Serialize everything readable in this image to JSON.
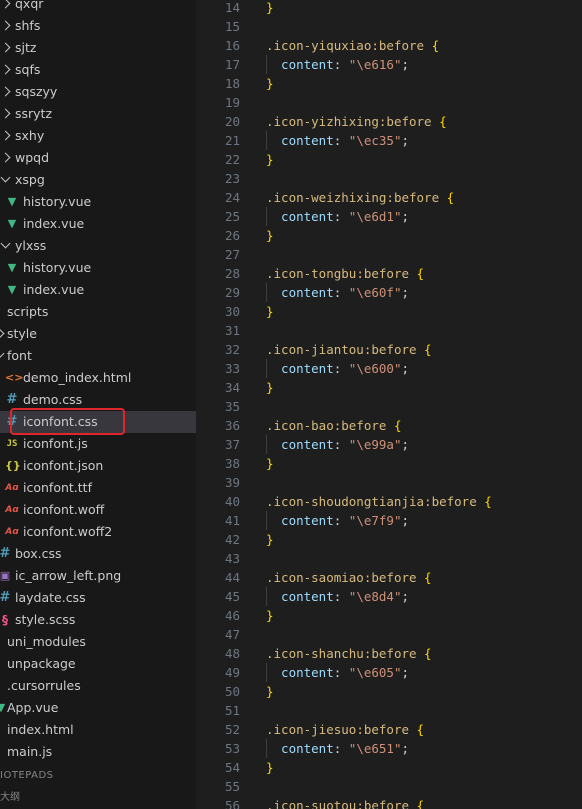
{
  "explorer": {
    "items": [
      {
        "label": "qxqr",
        "kind": "folder",
        "state": "closed",
        "depth": 0
      },
      {
        "label": "shfs",
        "kind": "folder",
        "state": "closed",
        "depth": 0
      },
      {
        "label": "sjtz",
        "kind": "folder",
        "state": "closed",
        "depth": 0
      },
      {
        "label": "sqfs",
        "kind": "folder",
        "state": "closed",
        "depth": 0
      },
      {
        "label": "sqszyy",
        "kind": "folder",
        "state": "closed",
        "depth": 0
      },
      {
        "label": "ssrytz",
        "kind": "folder",
        "state": "closed",
        "depth": 0
      },
      {
        "label": "sxhy",
        "kind": "folder",
        "state": "closed",
        "depth": 0
      },
      {
        "label": "wpqd",
        "kind": "folder",
        "state": "closed",
        "depth": 0
      },
      {
        "label": "xspg",
        "kind": "folder",
        "state": "open",
        "depth": 0
      },
      {
        "label": "history.vue",
        "kind": "vue",
        "depth": 1
      },
      {
        "label": "index.vue",
        "kind": "vue",
        "depth": 1
      },
      {
        "label": "ylxss",
        "kind": "folder",
        "state": "open",
        "depth": 0
      },
      {
        "label": "history.vue",
        "kind": "vue",
        "depth": 1
      },
      {
        "label": "index.vue",
        "kind": "vue",
        "depth": 1
      },
      {
        "label": "scripts",
        "kind": "folder-plain",
        "depth": -1
      },
      {
        "label": "style",
        "kind": "folder",
        "state": "closed",
        "depth": -1
      },
      {
        "label": "font",
        "kind": "folder",
        "state": "open",
        "depth": -1
      },
      {
        "label": "demo_index.html",
        "kind": "html",
        "depth": 1
      },
      {
        "label": "demo.css",
        "kind": "css",
        "depth": 1
      },
      {
        "label": "iconfont.css",
        "kind": "css",
        "depth": 1,
        "selected": true
      },
      {
        "label": "iconfont.js",
        "kind": "js",
        "depth": 1
      },
      {
        "label": "iconfont.json",
        "kind": "json",
        "depth": 1
      },
      {
        "label": "iconfont.ttf",
        "kind": "font",
        "depth": 1
      },
      {
        "label": "iconfont.woff",
        "kind": "font",
        "depth": 1
      },
      {
        "label": "iconfont.woff2",
        "kind": "font",
        "depth": 1
      },
      {
        "label": "box.css",
        "kind": "css",
        "depth": 0
      },
      {
        "label": "ic_arrow_left.png",
        "kind": "img",
        "depth": 0
      },
      {
        "label": "laydate.css",
        "kind": "css",
        "depth": 0
      },
      {
        "label": "style.scss",
        "kind": "scss",
        "depth": 0
      },
      {
        "label": "uni_modules",
        "kind": "folder-plain",
        "depth": -1
      },
      {
        "label": "unpackage",
        "kind": "folder-plain",
        "depth": -1
      },
      {
        "label": ".cursorrules",
        "kind": "folder-plain",
        "depth": -1
      },
      {
        "label": "App.vue",
        "kind": "vue-partial",
        "depth": -1
      },
      {
        "label": "index.html",
        "kind": "folder-plain",
        "depth": -1
      },
      {
        "label": "main.js",
        "kind": "folder-plain",
        "depth": -1
      }
    ],
    "section_notepads": "IOTEPADS",
    "section_outline": "大纲"
  },
  "editor": {
    "lines": [
      {
        "n": "14",
        "seg": [
          {
            "t": "}",
            "c": "brace"
          }
        ]
      },
      {
        "n": "15",
        "seg": []
      },
      {
        "n": "16",
        "seg": [
          {
            "t": ".icon-yiquxiao",
            "c": "sel"
          },
          {
            "t": ":before",
            "c": "pseudo"
          },
          {
            "t": " {",
            "c": "brace"
          }
        ]
      },
      {
        "n": "17",
        "seg": [
          {
            "t": "  content",
            "c": "prop"
          },
          {
            "t": ": ",
            "c": "punc"
          },
          {
            "t": "\"\\e616\"",
            "c": "str"
          },
          {
            "t": ";",
            "c": "punc"
          }
        ]
      },
      {
        "n": "18",
        "seg": [
          {
            "t": "}",
            "c": "brace"
          }
        ]
      },
      {
        "n": "19",
        "seg": []
      },
      {
        "n": "20",
        "seg": [
          {
            "t": ".icon-yizhixing",
            "c": "sel"
          },
          {
            "t": ":before",
            "c": "pseudo"
          },
          {
            "t": " {",
            "c": "brace"
          }
        ]
      },
      {
        "n": "21",
        "seg": [
          {
            "t": "  content",
            "c": "prop"
          },
          {
            "t": ": ",
            "c": "punc"
          },
          {
            "t": "\"\\ec35\"",
            "c": "str"
          },
          {
            "t": ";",
            "c": "punc"
          }
        ]
      },
      {
        "n": "22",
        "seg": [
          {
            "t": "}",
            "c": "brace"
          }
        ]
      },
      {
        "n": "23",
        "seg": []
      },
      {
        "n": "24",
        "seg": [
          {
            "t": ".icon-weizhixing",
            "c": "sel"
          },
          {
            "t": ":before",
            "c": "pseudo"
          },
          {
            "t": " {",
            "c": "brace"
          }
        ]
      },
      {
        "n": "25",
        "seg": [
          {
            "t": "  content",
            "c": "prop"
          },
          {
            "t": ": ",
            "c": "punc"
          },
          {
            "t": "\"\\e6d1\"",
            "c": "str"
          },
          {
            "t": ";",
            "c": "punc"
          }
        ]
      },
      {
        "n": "26",
        "seg": [
          {
            "t": "}",
            "c": "brace"
          }
        ]
      },
      {
        "n": "27",
        "seg": []
      },
      {
        "n": "28",
        "seg": [
          {
            "t": ".icon-tongbu",
            "c": "sel"
          },
          {
            "t": ":before",
            "c": "pseudo"
          },
          {
            "t": " {",
            "c": "brace"
          }
        ]
      },
      {
        "n": "29",
        "seg": [
          {
            "t": "  content",
            "c": "prop"
          },
          {
            "t": ": ",
            "c": "punc"
          },
          {
            "t": "\"\\e60f\"",
            "c": "str"
          },
          {
            "t": ";",
            "c": "punc"
          }
        ]
      },
      {
        "n": "30",
        "seg": [
          {
            "t": "}",
            "c": "brace"
          }
        ]
      },
      {
        "n": "31",
        "seg": []
      },
      {
        "n": "32",
        "seg": [
          {
            "t": ".icon-jiantou",
            "c": "sel"
          },
          {
            "t": ":before",
            "c": "pseudo"
          },
          {
            "t": " {",
            "c": "brace"
          }
        ]
      },
      {
        "n": "33",
        "seg": [
          {
            "t": "  content",
            "c": "prop"
          },
          {
            "t": ": ",
            "c": "punc"
          },
          {
            "t": "\"\\e600\"",
            "c": "str"
          },
          {
            "t": ";",
            "c": "punc"
          }
        ]
      },
      {
        "n": "34",
        "seg": [
          {
            "t": "}",
            "c": "brace"
          }
        ]
      },
      {
        "n": "35",
        "seg": []
      },
      {
        "n": "36",
        "seg": [
          {
            "t": ".icon-bao",
            "c": "sel"
          },
          {
            "t": ":before",
            "c": "pseudo"
          },
          {
            "t": " {",
            "c": "brace"
          }
        ]
      },
      {
        "n": "37",
        "seg": [
          {
            "t": "  content",
            "c": "prop"
          },
          {
            "t": ": ",
            "c": "punc"
          },
          {
            "t": "\"\\e99a\"",
            "c": "str"
          },
          {
            "t": ";",
            "c": "punc"
          }
        ]
      },
      {
        "n": "38",
        "seg": [
          {
            "t": "}",
            "c": "brace"
          }
        ]
      },
      {
        "n": "39",
        "seg": []
      },
      {
        "n": "40",
        "seg": [
          {
            "t": ".icon-shoudongtianjia",
            "c": "sel"
          },
          {
            "t": ":before",
            "c": "pseudo"
          },
          {
            "t": " {",
            "c": "brace"
          }
        ]
      },
      {
        "n": "41",
        "seg": [
          {
            "t": "  content",
            "c": "prop"
          },
          {
            "t": ": ",
            "c": "punc"
          },
          {
            "t": "\"\\e7f9\"",
            "c": "str"
          },
          {
            "t": ";",
            "c": "punc"
          }
        ]
      },
      {
        "n": "42",
        "seg": [
          {
            "t": "}",
            "c": "brace"
          }
        ]
      },
      {
        "n": "43",
        "seg": []
      },
      {
        "n": "44",
        "seg": [
          {
            "t": ".icon-saomiao",
            "c": "sel"
          },
          {
            "t": ":before",
            "c": "pseudo"
          },
          {
            "t": " {",
            "c": "brace"
          }
        ]
      },
      {
        "n": "45",
        "seg": [
          {
            "t": "  content",
            "c": "prop"
          },
          {
            "t": ": ",
            "c": "punc"
          },
          {
            "t": "\"\\e8d4\"",
            "c": "str"
          },
          {
            "t": ";",
            "c": "punc"
          }
        ]
      },
      {
        "n": "46",
        "seg": [
          {
            "t": "}",
            "c": "brace"
          }
        ]
      },
      {
        "n": "47",
        "seg": []
      },
      {
        "n": "48",
        "seg": [
          {
            "t": ".icon-shanchu",
            "c": "sel"
          },
          {
            "t": ":before",
            "c": "pseudo"
          },
          {
            "t": " {",
            "c": "brace"
          }
        ]
      },
      {
        "n": "49",
        "seg": [
          {
            "t": "  content",
            "c": "prop"
          },
          {
            "t": ": ",
            "c": "punc"
          },
          {
            "t": "\"\\e605\"",
            "c": "str"
          },
          {
            "t": ";",
            "c": "punc"
          }
        ]
      },
      {
        "n": "50",
        "seg": [
          {
            "t": "}",
            "c": "brace"
          }
        ]
      },
      {
        "n": "51",
        "seg": []
      },
      {
        "n": "52",
        "seg": [
          {
            "t": ".icon-jiesuo",
            "c": "sel"
          },
          {
            "t": ":before",
            "c": "pseudo"
          },
          {
            "t": " {",
            "c": "brace"
          }
        ]
      },
      {
        "n": "53",
        "seg": [
          {
            "t": "  content",
            "c": "prop"
          },
          {
            "t": ": ",
            "c": "punc"
          },
          {
            "t": "\"\\e651\"",
            "c": "str"
          },
          {
            "t": ";",
            "c": "punc"
          }
        ]
      },
      {
        "n": "54",
        "seg": [
          {
            "t": "}",
            "c": "brace"
          }
        ]
      },
      {
        "n": "55",
        "seg": []
      },
      {
        "n": "56",
        "seg": [
          {
            "t": ".icon-suotou",
            "c": "sel"
          },
          {
            "t": ":before",
            "c": "pseudo"
          },
          {
            "t": " {",
            "c": "brace"
          }
        ]
      }
    ]
  },
  "colors": {
    "selector": "#d7ba7d",
    "property": "#9cdcfe",
    "string": "#ce9178",
    "brace": "#ffd700",
    "highlight_box": "#e0262c"
  }
}
